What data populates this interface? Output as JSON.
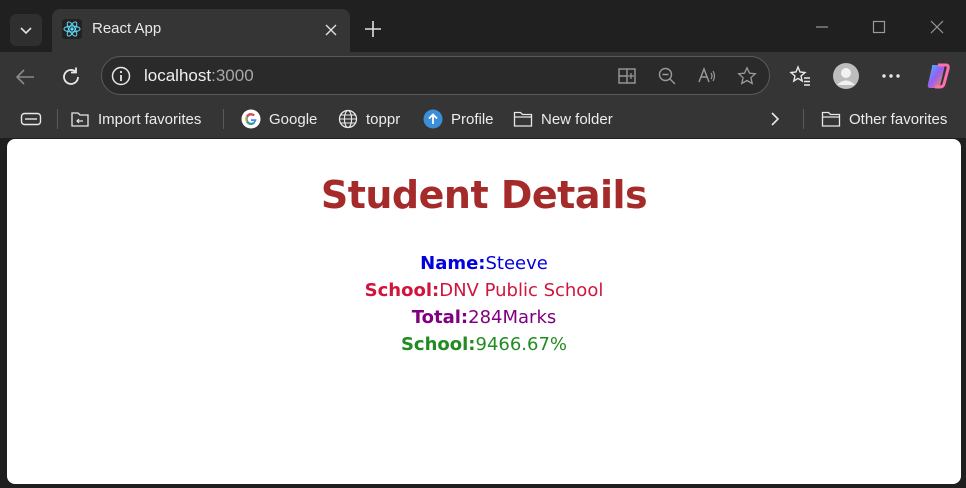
{
  "tab": {
    "title": "React App",
    "favicon": "react-logo-icon"
  },
  "address_bar": {
    "host": "localhost",
    "port": ":3000"
  },
  "favorites": [
    {
      "label": "Import favorites",
      "icon": "import-icon"
    },
    {
      "label": "Google",
      "icon": "google-icon"
    },
    {
      "label": "toppr",
      "icon": "globe-icon"
    },
    {
      "label": "Profile",
      "icon": "upload-circle-icon"
    },
    {
      "label": "New folder",
      "icon": "folder-icon"
    },
    {
      "label": "Other favorites",
      "icon": "folder-icon"
    }
  ],
  "page": {
    "heading": "Student Details",
    "rows": [
      {
        "label": "Name:",
        "value": "Steeve",
        "color": "#0000e0"
      },
      {
        "label": "School:",
        "value": "DNV Public School",
        "color": "#d0143c"
      },
      {
        "label": "Total:",
        "value": "284Marks",
        "color": "#800080"
      },
      {
        "label": "School:",
        "value": "9466.67%",
        "color": "#228b22"
      }
    ]
  },
  "colors": {
    "heading": "#a52a2a",
    "chrome_bg": "#202020",
    "toolbar_bg": "#353535"
  }
}
